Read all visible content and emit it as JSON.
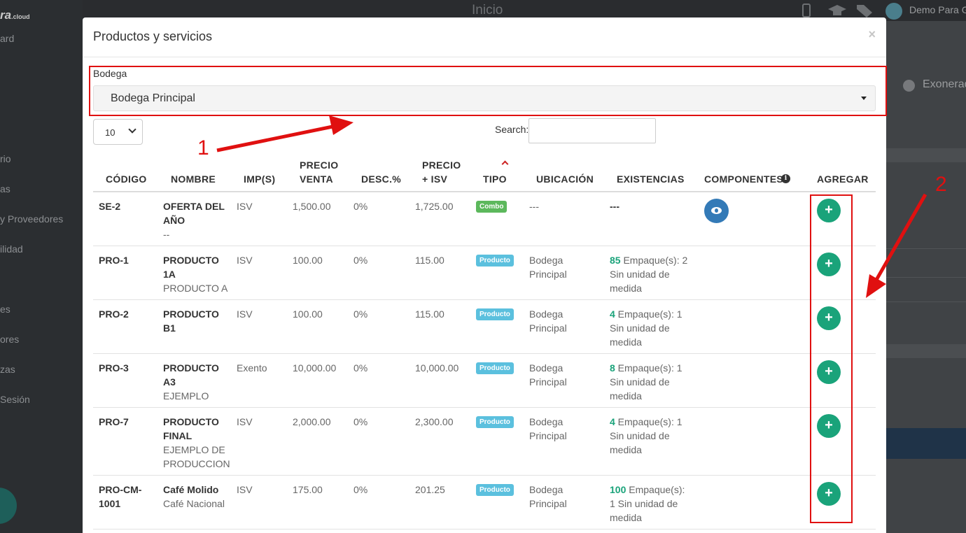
{
  "background": {
    "logo_text": "ra",
    "logo_sub": ".cloud",
    "sidebar_items": [
      "ard",
      "rio",
      "as",
      "y Proveedores",
      "ilidad",
      "es",
      "ores",
      "zas",
      "Sesión"
    ],
    "topbar_title": "Inicio",
    "user_name": "Demo Para G",
    "right_label": "Exonerad"
  },
  "modal": {
    "title": "Productos y servicios",
    "close": "×",
    "bodega_label": "Bodega",
    "bodega_value": "Bodega Principal",
    "page_length": "10",
    "search_label": "Search:",
    "search_value": ""
  },
  "table": {
    "headers": {
      "codigo": "CÓDIGO",
      "nombre": "NOMBRE",
      "imp": "IMP(S)",
      "precio_venta_1": "PRECIO",
      "precio_venta_2": "VENTA",
      "desc": "DESC.%",
      "precio_isv_1": "PRECIO",
      "precio_isv_2": "+ ISV",
      "tipo": "TIPO",
      "ubicacion": "UBICACIÓN",
      "existencias": "EXISTENCIAS",
      "componentes": "COMPONENTES",
      "agregar": "AGREGAR"
    },
    "rows": [
      {
        "code": "SE-2",
        "name": "OFERTA DEL AÑO",
        "desc_text": "--",
        "imp": "ISV",
        "precio_venta": "1,500.00",
        "descuento": "0%",
        "precio_isv": "1,725.00",
        "tipo": "Combo",
        "ubicacion": "---",
        "stock_num": "",
        "stock_text": "---"
      },
      {
        "code": "PRO-1",
        "name": "PRODUCTO 1A",
        "desc_text": "PRODUCTO A",
        "imp": "ISV",
        "precio_venta": "100.00",
        "descuento": "0%",
        "precio_isv": "115.00",
        "tipo": "Producto",
        "ubicacion": "Bodega Principal",
        "stock_num": "85",
        "stock_text": " Empaque(s): 2 Sin unidad de medida"
      },
      {
        "code": "PRO-2",
        "name": "PRODUCTO B1",
        "desc_text": "",
        "imp": "ISV",
        "precio_venta": "100.00",
        "descuento": "0%",
        "precio_isv": "115.00",
        "tipo": "Producto",
        "ubicacion": "Bodega Principal",
        "stock_num": "4",
        "stock_text": " Empaque(s): 1 Sin unidad de medida"
      },
      {
        "code": "PRO-3",
        "name": "PRODUCTO A3",
        "desc_text": "EJEMPLO",
        "imp": "Exento",
        "precio_venta": "10,000.00",
        "descuento": "0%",
        "precio_isv": "10,000.00",
        "tipo": "Producto",
        "ubicacion": "Bodega Principal",
        "stock_num": "8",
        "stock_text": " Empaque(s): 1 Sin unidad de medida"
      },
      {
        "code": "PRO-7",
        "name": "PRODUCTO FINAL",
        "desc_text": "EJEMPLO DE PRODUCCION",
        "imp": "ISV",
        "precio_venta": "2,000.00",
        "descuento": "0%",
        "precio_isv": "2,300.00",
        "tipo": "Producto",
        "ubicacion": "Bodega Principal",
        "stock_num": "4",
        "stock_text": " Empaque(s): 1 Sin unidad de medida"
      },
      {
        "code": "PRO-CM-1001",
        "name": "Café Molido",
        "desc_text": "Café Nacional",
        "imp": "ISV",
        "precio_venta": "175.00",
        "descuento": "0%",
        "precio_isv": "201.25",
        "tipo": "Producto",
        "ubicacion": "Bodega Principal",
        "stock_num": "100",
        "stock_text": " Empaque(s): 1 Sin unidad de medida"
      }
    ],
    "add_label": "+"
  },
  "annotations": {
    "label_1": "1",
    "label_2": "2",
    "color": "#e01010"
  },
  "colors": {
    "accent_green": "#1aa37a",
    "combo_badge": "#5cb85c",
    "product_badge": "#5bc0de",
    "view_button": "#337ab7"
  }
}
